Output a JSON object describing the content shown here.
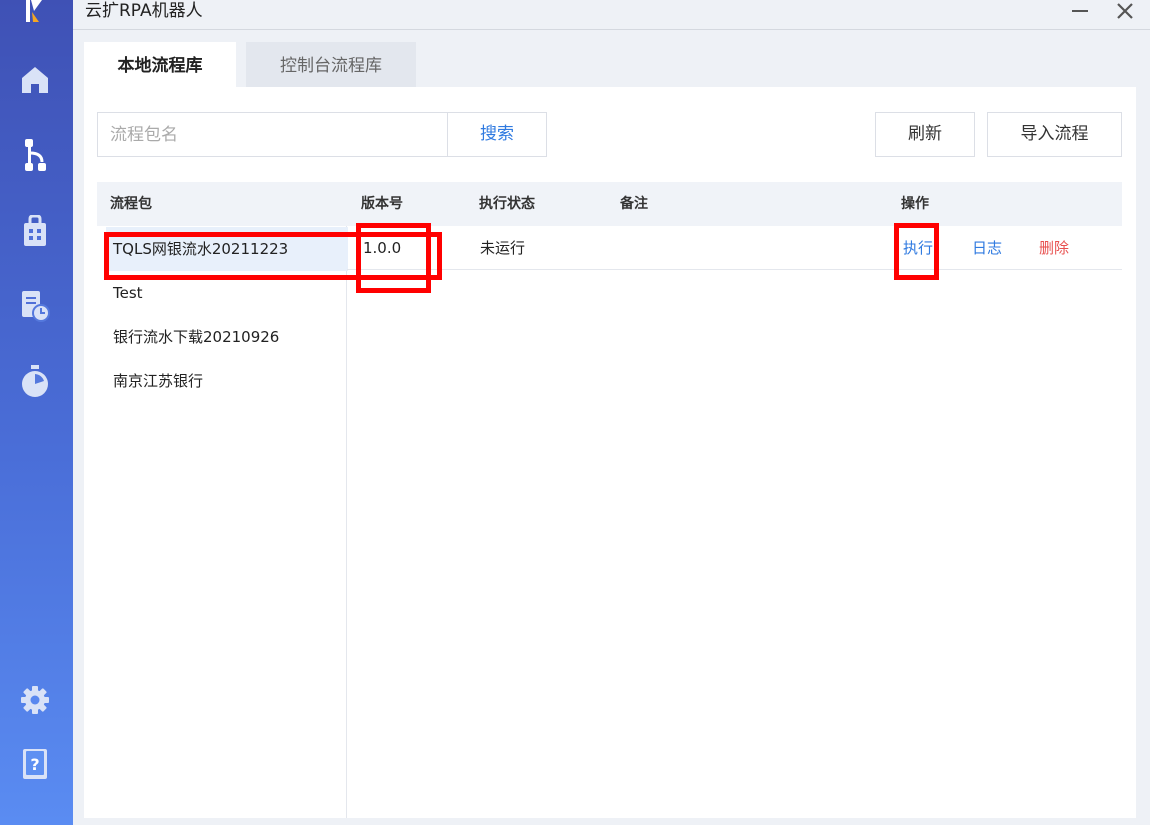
{
  "window": {
    "title": "云扩RPA机器人",
    "minimize_icon": "minimize-icon",
    "close_icon": "close-icon"
  },
  "sidebar": {
    "logo": "app-logo",
    "items": [
      {
        "icon": "home-icon"
      },
      {
        "icon": "flow-icon"
      },
      {
        "icon": "package-icon"
      },
      {
        "icon": "schedule-doc-icon"
      },
      {
        "icon": "timer-icon"
      }
    ],
    "bottom_items": [
      {
        "icon": "gear-icon"
      },
      {
        "icon": "help-book-icon"
      }
    ]
  },
  "tabs": [
    {
      "label": "本地流程库",
      "active": true
    },
    {
      "label": "控制台流程库",
      "active": false
    }
  ],
  "toolbar": {
    "search_placeholder": "流程包名",
    "search_value": "",
    "search_label": "搜索",
    "refresh_label": "刷新",
    "import_label": "导入流程"
  },
  "table": {
    "columns": [
      "流程包",
      "版本号",
      "执行状态",
      "备注",
      "操作"
    ],
    "packages": [
      "TQLS网银流水20211223",
      "Test",
      "银行流水下载20210926",
      "南京江苏银行"
    ],
    "selected_index": 0,
    "row": {
      "version": "1.0.0",
      "status": "未运行",
      "note": "",
      "actions": {
        "execute": "执行",
        "log": "日志",
        "delete": "删除"
      }
    }
  },
  "colors": {
    "sidebar_top": "#3f51b5",
    "sidebar_bottom": "#5a8cf2",
    "link_blue": "#2f7ae0",
    "danger_red": "#e8504f",
    "highlight_red": "#ff0000",
    "selected_row": "#e8f0fb"
  }
}
